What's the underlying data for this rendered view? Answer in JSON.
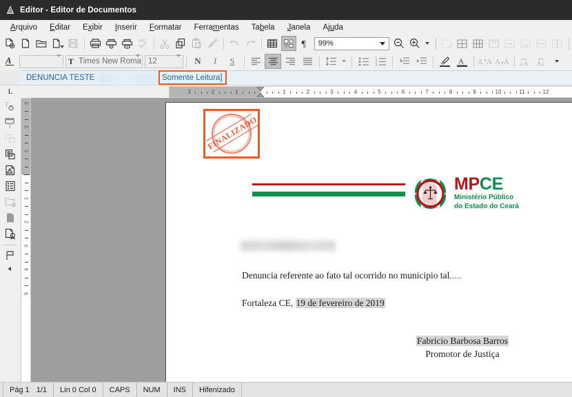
{
  "window": {
    "title": "Editor - Editor de Documentos",
    "icon": "app-icon"
  },
  "menubar": {
    "items": [
      {
        "label": "Arquivo",
        "accel": "A"
      },
      {
        "label": "Editar",
        "accel": "E"
      },
      {
        "label": "Exibir",
        "accel": "x"
      },
      {
        "label": "Inserir",
        "accel": "I"
      },
      {
        "label": "Formatar",
        "accel": "F"
      },
      {
        "label": "Ferramentas",
        "accel": "m"
      },
      {
        "label": "Tabela",
        "accel": "b"
      },
      {
        "label": "Janela",
        "accel": "J"
      },
      {
        "label": "Ajuda",
        "accel": "u"
      }
    ]
  },
  "toolbar_main": {
    "zoom_value": "99%",
    "buttons": [
      {
        "name": "new-document-button",
        "icon": "new-document-icon"
      },
      {
        "name": "open-document-button",
        "icon": "blank-page-icon"
      },
      {
        "name": "open-folder-button",
        "icon": "open-folder-icon"
      },
      {
        "name": "open-recent-button",
        "icon": "document-dropdown-icon"
      },
      {
        "name": "save-button",
        "icon": "floppy-save-icon",
        "disabled": true
      },
      {
        "name": "print-button",
        "icon": "printer-icon"
      },
      {
        "name": "print-preview-button",
        "icon": "print-preview-icon"
      },
      {
        "name": "export-pdf-button",
        "icon": "export-pdf-icon"
      },
      {
        "name": "spellcheck-button",
        "icon": "spellcheck-abc-icon",
        "disabled": true
      },
      {
        "name": "cut-button",
        "icon": "scissors-icon",
        "disabled": true
      },
      {
        "name": "copy-button",
        "icon": "copy-icon"
      },
      {
        "name": "paste-button",
        "icon": "clipboard-paste-icon",
        "disabled": true
      },
      {
        "name": "format-paintbrush-button",
        "icon": "paintbrush-icon",
        "disabled": true
      },
      {
        "name": "undo-button",
        "icon": "undo-arrow-icon",
        "disabled": true
      },
      {
        "name": "redo-button",
        "icon": "redo-arrow-icon",
        "disabled": true
      },
      {
        "name": "insert-table-button",
        "icon": "table-grid-icon"
      },
      {
        "name": "show-draw-functions-button",
        "icon": "draw-functions-icon",
        "pressed": true
      },
      {
        "name": "formatting-marks-button",
        "icon": "pilcrow-icon"
      },
      {
        "name": "zoom-out-button",
        "icon": "zoom-out-magnifier-icon"
      },
      {
        "name": "zoom-in-button",
        "icon": "zoom-in-magnifier-icon"
      },
      {
        "name": "toolbar-overflow-button",
        "icon": "chevron-down-icon"
      }
    ],
    "table_cell_buttons": [
      {
        "name": "table-merge-cells-button",
        "icon": "cell-merge-icon"
      },
      {
        "name": "table-split-cells-button",
        "icon": "cell-split-icon"
      },
      {
        "name": "table-optimize-button",
        "icon": "cell-optimize-icon"
      },
      {
        "name": "table-align-top-button",
        "icon": "cell-align-top-icon"
      },
      {
        "name": "table-align-center-button",
        "icon": "cell-align-center-icon"
      },
      {
        "name": "table-align-bottom-button",
        "icon": "cell-align-bottom-icon"
      },
      {
        "name": "table-insert-row-button",
        "icon": "cell-insert-row-icon"
      },
      {
        "name": "table-insert-col-button",
        "icon": "cell-insert-col-icon"
      }
    ]
  },
  "toolbar_format": {
    "paragraph_style_value": "",
    "font_name_value": "Times New Roma",
    "font_size_value": "12",
    "bold_label": "N",
    "italic_label": "I",
    "underline_label": "S",
    "buttons": [
      {
        "name": "apply-style-button",
        "icon": "style-a-icon"
      },
      {
        "name": "bold-button",
        "icon": "bold-icon"
      },
      {
        "name": "italic-button",
        "icon": "italic-icon"
      },
      {
        "name": "underline-button",
        "icon": "underline-icon"
      },
      {
        "name": "align-left-button",
        "icon": "align-left-icon"
      },
      {
        "name": "align-center-button",
        "icon": "align-center-icon",
        "pressed": true
      },
      {
        "name": "align-right-button",
        "icon": "align-right-icon"
      },
      {
        "name": "align-justify-button",
        "icon": "align-justify-icon"
      },
      {
        "name": "line-spacing-button",
        "icon": "line-spacing-icon"
      },
      {
        "name": "line-spacing-dropdown",
        "icon": "chevron-down-icon"
      },
      {
        "name": "bullet-list-button",
        "icon": "bullet-list-icon"
      },
      {
        "name": "numbered-list-button",
        "icon": "numbered-list-icon"
      },
      {
        "name": "decrease-indent-button",
        "icon": "decrease-indent-icon"
      },
      {
        "name": "increase-indent-button",
        "icon": "increase-indent-icon"
      },
      {
        "name": "highlight-color-button",
        "icon": "highlighter-pen-icon"
      },
      {
        "name": "font-color-button",
        "icon": "font-color-a-icon"
      },
      {
        "name": "increase-font-size-button",
        "icon": "grow-font-icon"
      },
      {
        "name": "decrease-font-size-button",
        "icon": "shrink-font-icon"
      },
      {
        "name": "superscript-button",
        "icon": "superscript-icon"
      },
      {
        "name": "subscript-button",
        "icon": "subscript-icon"
      },
      {
        "name": "format-overflow-button",
        "icon": "chevron-down-icon"
      }
    ]
  },
  "sidebar": {
    "buttons": [
      {
        "name": "text-cursor-tool",
        "icon": "text-select-icon"
      },
      {
        "name": "text-frame-tool",
        "icon": "text-frame-icon"
      },
      {
        "name": "insert-field-tool",
        "icon": "field-insert-icon"
      },
      {
        "name": "duplicate-document-tool",
        "icon": "duplicate-doc-icon"
      },
      {
        "name": "warning-document-tool",
        "icon": "document-warning-icon"
      },
      {
        "name": "list-document-tool",
        "icon": "document-list-icon"
      },
      {
        "name": "folder-tool",
        "icon": "folder-outline-icon",
        "disabled": true
      },
      {
        "name": "page-tool",
        "icon": "filled-page-icon"
      },
      {
        "name": "certificate-tool",
        "icon": "document-seal-icon"
      },
      {
        "name": "flag-tool",
        "icon": "flag-icon"
      },
      {
        "name": "sidebar-collapse-button",
        "icon": "triangle-left-icon"
      }
    ]
  },
  "document_strip": {
    "doc_name": "DENUNCIA TESTE",
    "redacted": true,
    "read_only_label": "Somente Leitura]",
    "highlight_color": "#ef5a22"
  },
  "ruler": {
    "corner_label": "L",
    "h_numbers_left": [
      "3",
      "2",
      "1"
    ],
    "h_numbers_right": [
      "1",
      "2",
      "3",
      "4",
      "5",
      "6",
      "7",
      "8",
      "9",
      "10",
      "11",
      "12"
    ],
    "v_numbers_top": [
      "3",
      "2",
      "1"
    ],
    "v_numbers_bottom": [
      "1",
      "2",
      "3",
      "4",
      "5"
    ]
  },
  "document": {
    "stamp_text": "FINALIZADO",
    "stamp_color": "#ee5a3a",
    "logo": {
      "brand_mp": "MP",
      "brand_ce": "CE",
      "subtitle_line1": "Ministério Público",
      "subtitle_line2": "do Estado do Ceará",
      "red": "#b4161b",
      "green": "#0d8f4f"
    },
    "redacted_line": true,
    "paragraph_1": "Denuncia referente ao fato tal ocorrido no municipio tal",
    "paragraph_1_dots": ".....",
    "paragraph_2_prefix": "Fortaleza CE, ",
    "paragraph_2_field": "19 de fevereiro de 2019",
    "signature_name": "Fabricio Barbosa Barros",
    "signature_role": "Promotor de Justiça"
  },
  "statusbar": {
    "page": "Pág 1",
    "page_count": "1/1",
    "line_col": "Lin 0  Col 0",
    "caps": "CAPS",
    "num": "NUM",
    "ins": "INS",
    "hyphenation": "Hifenizado"
  }
}
